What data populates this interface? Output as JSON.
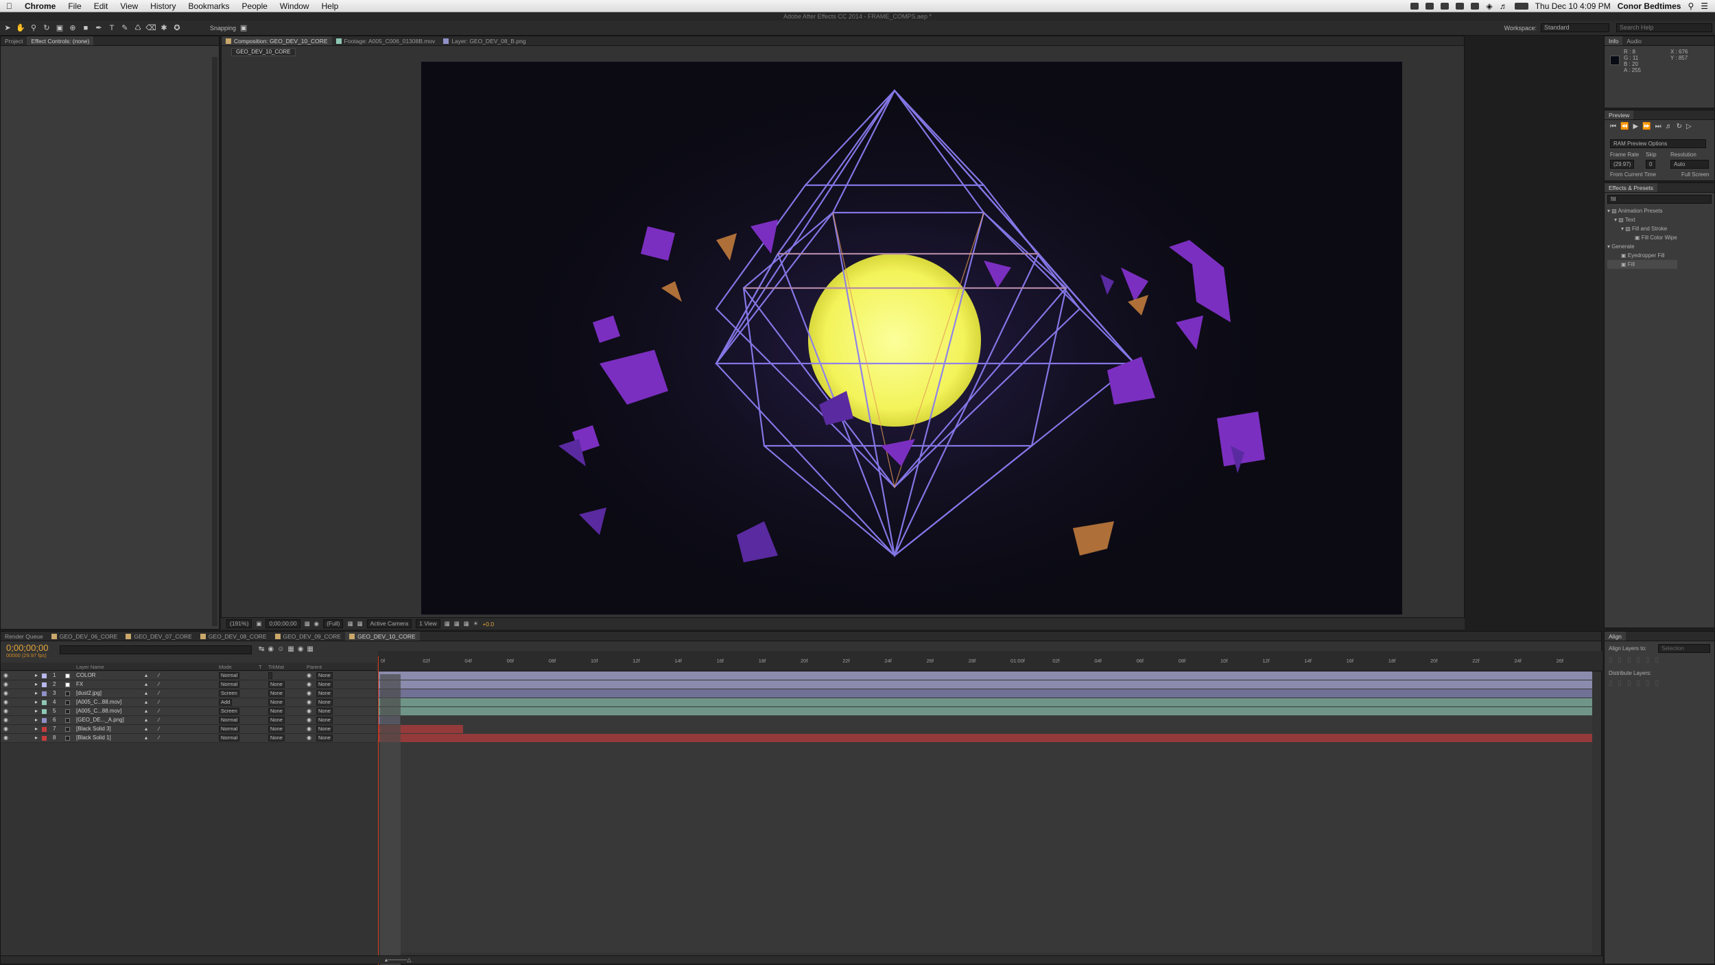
{
  "menubar": {
    "app": "Chrome",
    "items": [
      "File",
      "Edit",
      "View",
      "History",
      "Bookmarks",
      "People",
      "Window",
      "Help"
    ],
    "clock": "Thu Dec 10  4:09 PM",
    "user": "Conor Bedtimes"
  },
  "app_title": "Adobe After Effects CC 2014 - FRAME_COMPS.aep *",
  "toolbar": {
    "snapping": "Snapping",
    "workspace_label": "Workspace:",
    "workspace_value": "Standard",
    "search_placeholder": "Search Help"
  },
  "left_panel": {
    "tabs": [
      "Project",
      "Effect Controls: (none)"
    ]
  },
  "viewer": {
    "tabs": [
      "Composition: GEO_DEV_10_CORE",
      "Footage: A005_C006_01308B.mov",
      "Layer: GEO_DEV_08_B.png"
    ],
    "comp_name": "GEO_DEV_10_CORE",
    "zoom": "(191%)",
    "timecode": "0;00;00;00",
    "resolution": "(Full)",
    "camera": "Active Camera",
    "views": "1 View",
    "exposure": "+0.0"
  },
  "info": {
    "tabs": [
      "Info",
      "Audio"
    ],
    "rgba": [
      "R : 8",
      "G : 11",
      "B : 20",
      "A : 255"
    ],
    "xy": [
      "X : 676",
      "Y : 857"
    ]
  },
  "preview": {
    "title": "Preview",
    "ram": "RAM Preview Options",
    "labels": [
      "Frame Rate",
      "Skip",
      "Resolution"
    ],
    "values": [
      "(29.97)",
      "0",
      "Auto"
    ],
    "from_current": "From Current Time",
    "full_screen": "Full Screen"
  },
  "effects": {
    "title": "Effects & Presets",
    "search_value": "fill",
    "tree": [
      "Animation Presets",
      "Text",
      "Fill and Stroke",
      "Fill Color Wipe",
      "Generate",
      "Eyedropper Fill",
      "Fill"
    ]
  },
  "timeline": {
    "tabs": [
      "Render Queue",
      "GEO_DEV_06_CORE",
      "GEO_DEV_07_CORE",
      "GEO_DEV_08_CORE",
      "GEO_DEV_09_CORE",
      "GEO_DEV_10_CORE"
    ],
    "timecode": "0;00;00;00",
    "fps": "00000 (29.97 fps)",
    "search_placeholder": "",
    "cols": [
      "Layer Name",
      "Mode",
      "T",
      "TrkMat",
      "Parent"
    ],
    "layers": [
      {
        "num": "1",
        "name": "COLOR",
        "mode": "Normal",
        "trkmat": "",
        "parent": "None",
        "color": "#b8b8ec"
      },
      {
        "num": "2",
        "name": "FX",
        "mode": "Normal",
        "trkmat": "None",
        "parent": "None",
        "color": "#b8b8ec"
      },
      {
        "num": "3",
        "name": "[dust2.jpg]",
        "mode": "Screen",
        "trkmat": "None",
        "parent": "None",
        "color": "#9090c8"
      },
      {
        "num": "4",
        "name": "[A005_C...88.mov]",
        "mode": "Add",
        "trkmat": "None",
        "parent": "None",
        "color": "#8ec8b4"
      },
      {
        "num": "5",
        "name": "[A005_C...88.mov]",
        "mode": "Screen",
        "trkmat": "None",
        "parent": "None",
        "color": "#8ec8b4"
      },
      {
        "num": "6",
        "name": "[GEO_DE..._A.png]",
        "mode": "Normal",
        "trkmat": "None",
        "parent": "None",
        "color": "#9090c8"
      },
      {
        "num": "7",
        "name": "[Black Solid 3]",
        "mode": "Normal",
        "trkmat": "None",
        "parent": "None",
        "color": "#c83c3c"
      },
      {
        "num": "8",
        "name": "[Black Solid 1]",
        "mode": "Normal",
        "trkmat": "None",
        "parent": "None",
        "color": "#c83c3c"
      }
    ],
    "ticks": [
      "0f",
      "02f",
      "04f",
      "06f",
      "08f",
      "10f",
      "12f",
      "14f",
      "16f",
      "18f",
      "20f",
      "22f",
      "24f",
      "26f",
      "28f",
      "01:00f",
      "02f",
      "04f",
      "06f",
      "08f",
      "10f",
      "12f",
      "14f",
      "16f",
      "18f",
      "20f",
      "22f",
      "24f",
      "26f"
    ]
  },
  "align": {
    "title": "Align",
    "align_to_label": "Align Layers to:",
    "align_to_value": "Selection",
    "distribute": "Distribute Layers:"
  }
}
